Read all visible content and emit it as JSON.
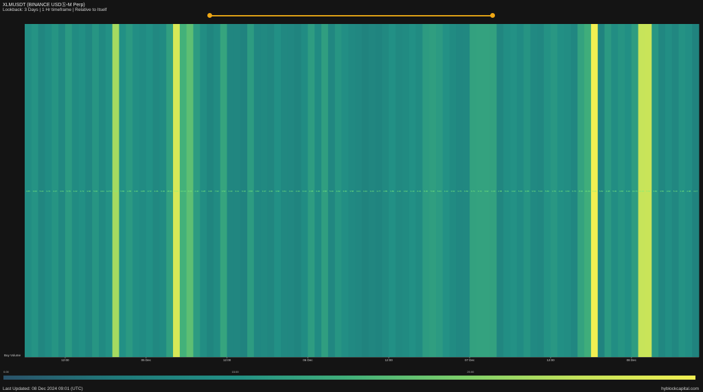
{
  "header": {
    "title": "XLMUSDT (BINANCE USDⓈ-M Perp)",
    "subtitle": "Lookback: 3 Days | 1 Hr timeframe | Relative to Itself"
  },
  "range_slider": {
    "start": 0.0,
    "end": 1.0
  },
  "colorbar": {
    "ticks": [
      "0.00",
      "15.00",
      "20.00"
    ],
    "colors": [
      "#2a5269",
      "#1f7a7a",
      "#229085",
      "#42b07a",
      "#7fd06a",
      "#c5e35a",
      "#f1ef52"
    ]
  },
  "footer": {
    "left": "Last Updated: 08 Dec 2024 09:01 (UTC)",
    "right": "hyblockcapital.com"
  },
  "chart_data": {
    "type": "heatmap",
    "row_label": "Buy Volume",
    "x_tick_labels": [
      "12:00",
      "05 Dec",
      "12:00",
      "06 Dec",
      "12:00",
      "07 Dec",
      "12:00",
      "08 Dec"
    ],
    "x_tick_hours": [
      6,
      18,
      30,
      42,
      54,
      66,
      78,
      90
    ],
    "hours": 100,
    "values": [
      4.4,
      5.2,
      3.4,
      4.3,
      5.3,
      3.7,
      5.8,
      4.1,
      4.7,
      3.6,
      5.4,
      4.0,
      5.0,
      14.5,
      4.9,
      5.8,
      4.6,
      4.2,
      4.9,
      3.7,
      4.1,
      6.4,
      18.3,
      8.4,
      10.1,
      6.0,
      4.4,
      3.3,
      4.1,
      7.0,
      3.5,
      3.4,
      3.1,
      6.0,
      3.6,
      3.8,
      3.5,
      4.9,
      3.7,
      3.6,
      3.2,
      4.3,
      6.1,
      4.1,
      6.3,
      3.6,
      5.4,
      4.6,
      3.9,
      3.6,
      3.0,
      3.4,
      3.2,
      3.8,
      4.9,
      3.8,
      4.1,
      4.9,
      4.1,
      6.0,
      6.3,
      5.9,
      5.0,
      4.1,
      3.6,
      3.7,
      6.6,
      6.7,
      6.7,
      6.6,
      3.4,
      4.6,
      5.0,
      4.2,
      5.3,
      3.9,
      3.6,
      5.1,
      5.6,
      4.7,
      4.4,
      3.6,
      6.7,
      8.0,
      21.0,
      3.1,
      5.8,
      4.4,
      5.3,
      4.7,
      6.1,
      16.7,
      16.9,
      5.5,
      3.6,
      4.5,
      3.6,
      5.1,
      4.5,
      3.0
    ],
    "value_range": [
      0,
      21
    ],
    "labels_per_cell": [
      "3.85",
      "3.00",
      "5.22",
      "3.72",
      "4.17",
      "4.64",
      "5.76",
      "4.22",
      "4.72",
      "3.66",
      "5.40",
      "4.04",
      "14.50",
      "4.92",
      "5.80",
      "4.58",
      "4.20",
      "4.88",
      "3.72",
      "4.06",
      "6.40",
      "18.33",
      "8.41",
      "10.10",
      "6.00",
      "4.40",
      "3.28",
      "4.06",
      "7.02",
      "3.52",
      "3.40",
      "3.11",
      "6.02",
      "3.58",
      "3.82",
      "3.47",
      "4.90",
      "3.66",
      "3.61",
      "3.24",
      "4.30",
      "6.10",
      "4.08",
      "6.30",
      "3.58",
      "5.40",
      "4.62",
      "3.90",
      "3.58",
      "3.01",
      "3.44",
      "3.20",
      "3.77",
      "4.86",
      "3.80",
      "4.10",
      "4.92",
      "4.10",
      "6.01",
      "6.30",
      "5.92",
      "5.04",
      "4.12",
      "3.62",
      "3.70",
      "6.60",
      "6.71",
      "6.72",
      "6.62",
      "3.40",
      "4.58",
      "5.01",
      "4.22",
      "5.30",
      "3.88",
      "3.61",
      "5.10",
      "5.60",
      "4.70",
      "4.40",
      "3.60",
      "6.70",
      "8.02",
      "21.00",
      "3.10",
      "5.82",
      "4.38",
      "5.30",
      "4.68",
      "6.10",
      "16.70",
      "16.90",
      "5.52",
      "3.60",
      "4.50",
      "3.62",
      "5.10",
      "4.48",
      "2.98",
      "4.17"
    ]
  }
}
